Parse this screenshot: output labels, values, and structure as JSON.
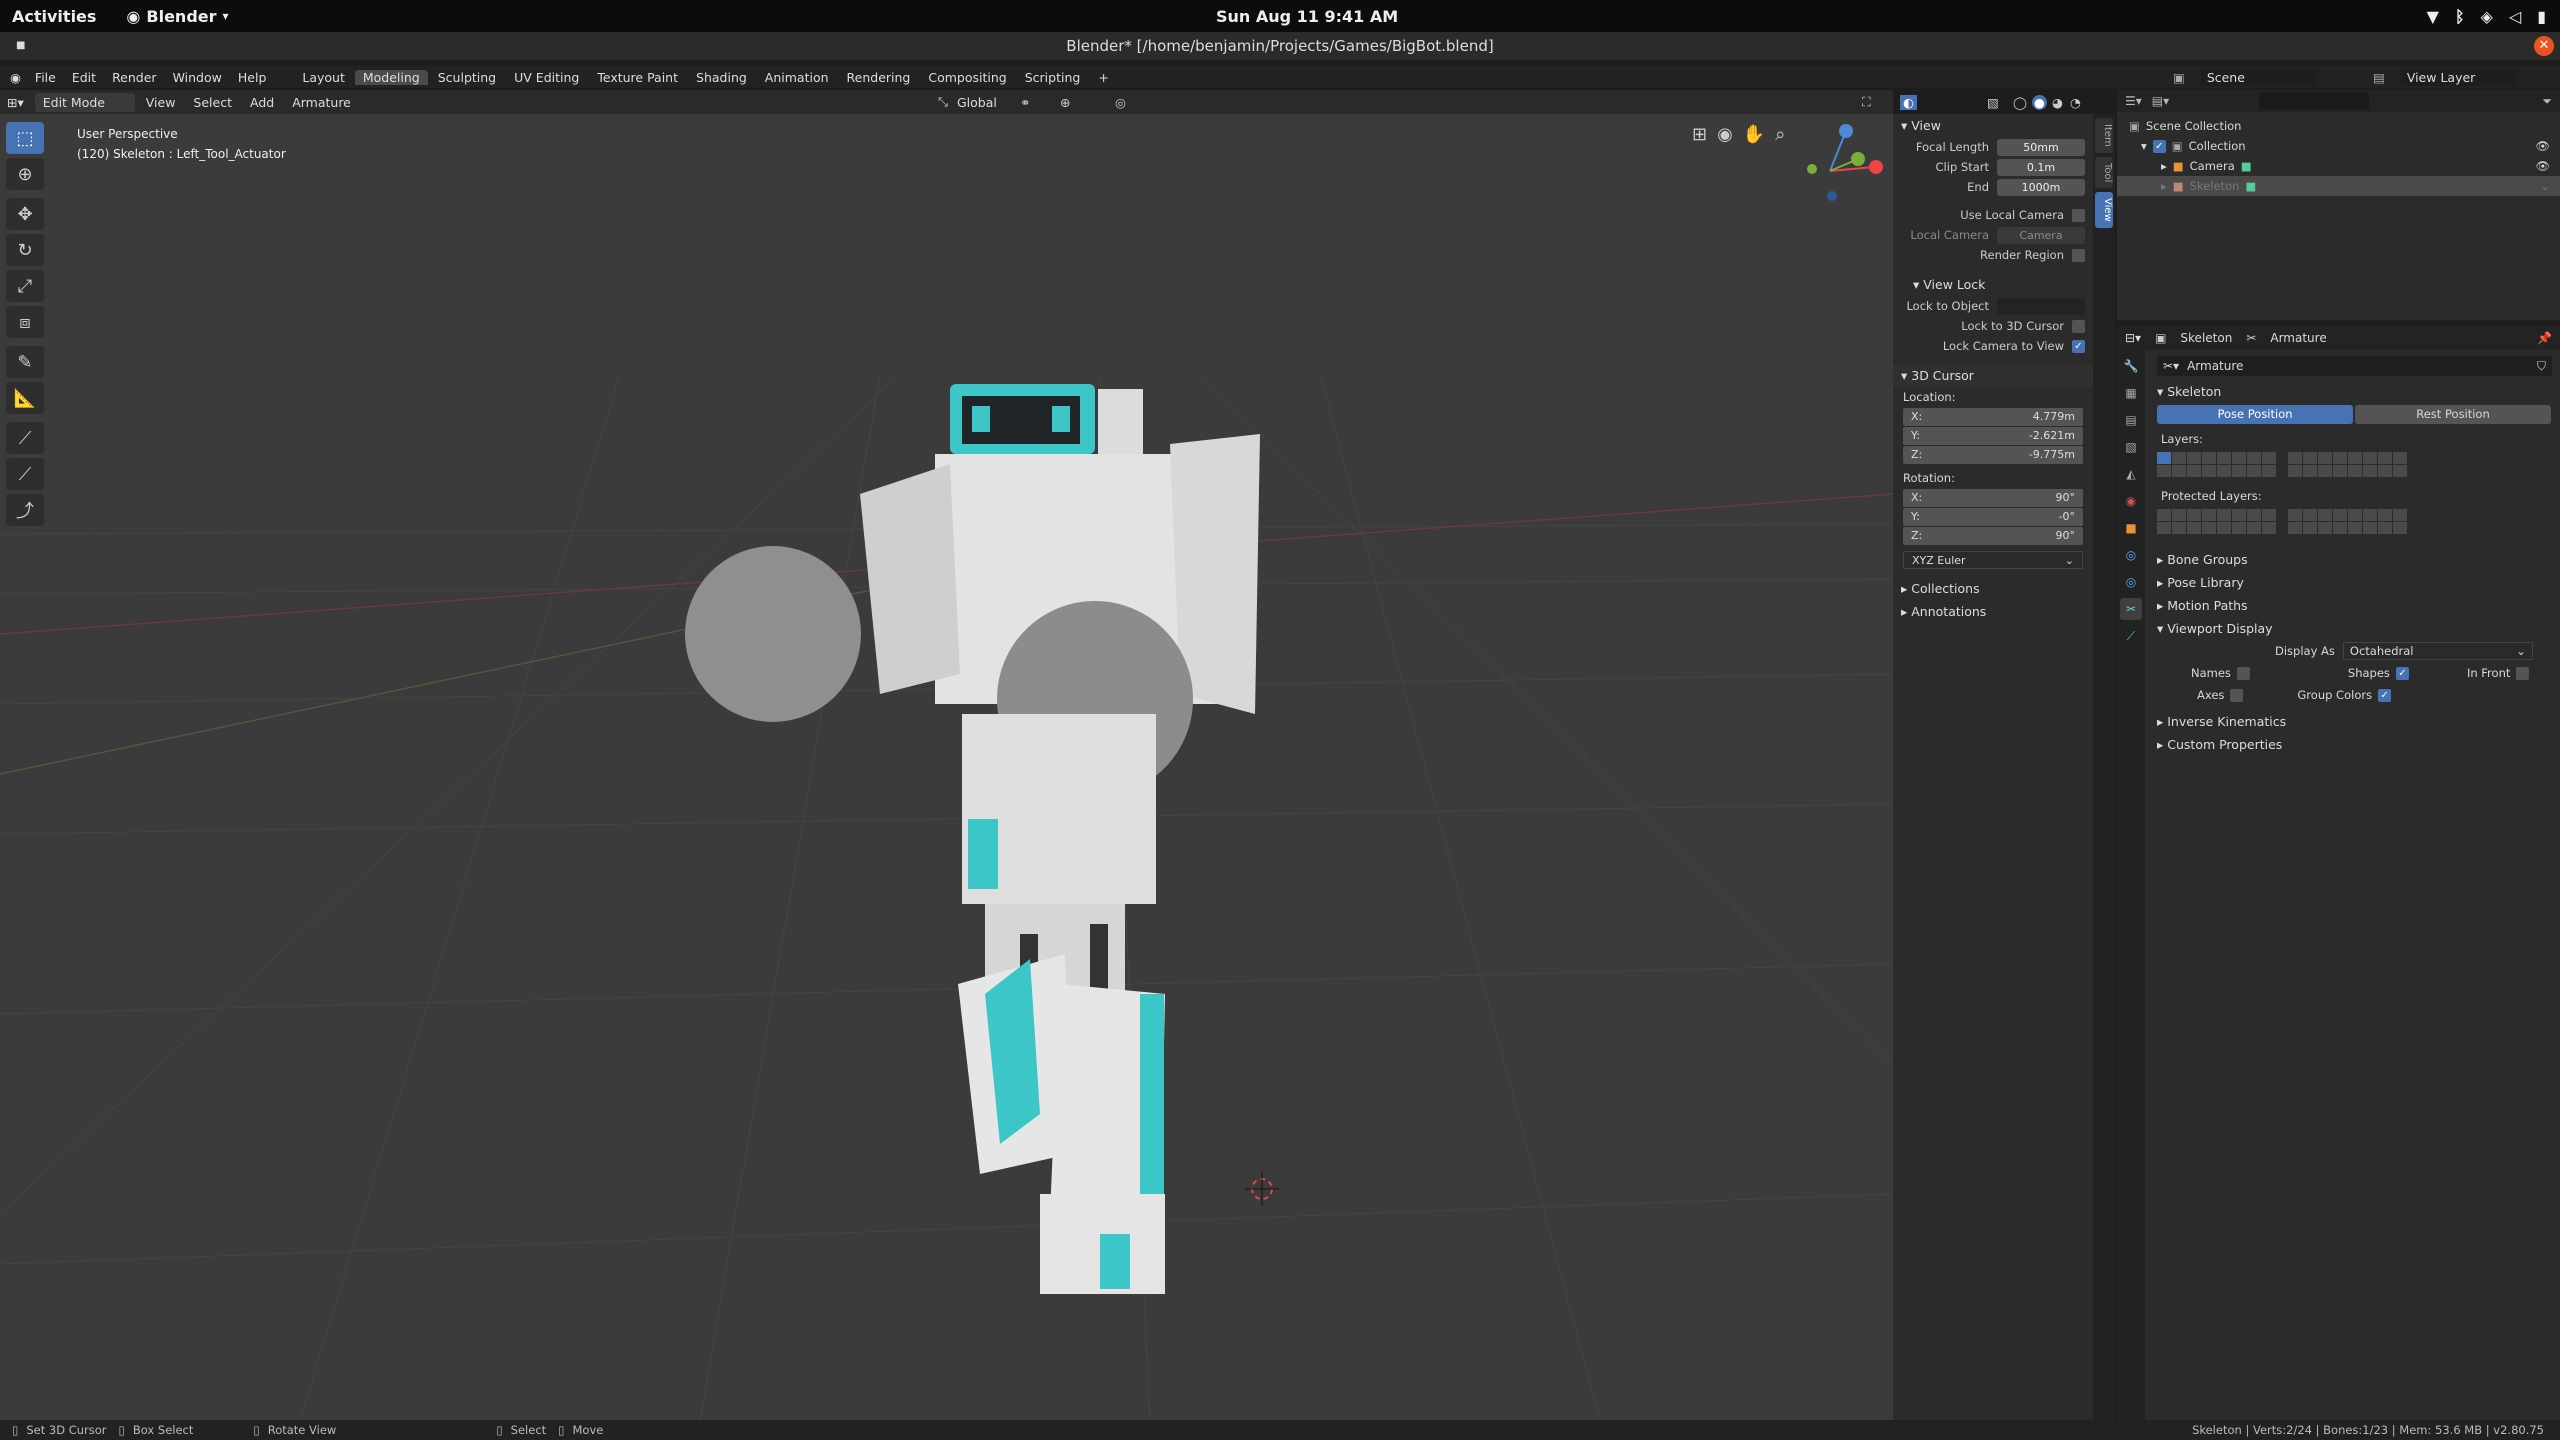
{
  "gnome": {
    "activities": "Activities",
    "app": "Blender",
    "app_caret": "▾",
    "clock": "Sun Aug 11  9:41 AM"
  },
  "title": "Blender* [/home/benjamin/Projects/Games/BigBot.blend]",
  "menu": [
    "File",
    "Edit",
    "Render",
    "Window",
    "Help"
  ],
  "workspaces": [
    "Layout",
    "Modeling",
    "Sculpting",
    "UV Editing",
    "Texture Paint",
    "Shading",
    "Animation",
    "Rendering",
    "Compositing",
    "Scripting"
  ],
  "workspace_plus": "+",
  "active_workspace": "Modeling",
  "viewport_header": {
    "mode": "Edit Mode",
    "menus": [
      "View",
      "Select",
      "Add",
      "Armature"
    ],
    "orientation": "Global"
  },
  "overlay_text": {
    "perspective": "User Perspective",
    "object": "(120) Skeleton : Left_Tool_Actuator"
  },
  "npanel": {
    "tabs": [
      "Item",
      "Tool",
      "View"
    ],
    "active_tab": "View",
    "view_section": "View",
    "focal_length": {
      "label": "Focal Length",
      "value": "50mm"
    },
    "clip_start": {
      "label": "Clip Start",
      "value": "0.1m"
    },
    "clip_end": {
      "label": "End",
      "value": "1000m"
    },
    "use_local_camera": "Use Local Camera",
    "local_camera": {
      "label": "Local Camera",
      "value": "Camera"
    },
    "render_region": "Render Region",
    "view_lock_section": "View Lock",
    "lock_to_object": "Lock to Object",
    "lock_to_3d_cursor": "Lock to 3D Cursor",
    "lock_camera_to_view": "Lock Camera to View",
    "cursor_section": "3D Cursor",
    "location_label": "Location:",
    "location": [
      {
        "axis": "X:",
        "value": "4.779m"
      },
      {
        "axis": "Y:",
        "value": "-2.621m"
      },
      {
        "axis": "Z:",
        "value": "-9.775m"
      }
    ],
    "rotation_label": "Rotation:",
    "rotation": [
      {
        "axis": "X:",
        "value": "90°"
      },
      {
        "axis": "Y:",
        "value": "-0°"
      },
      {
        "axis": "Z:",
        "value": "90°"
      }
    ],
    "rotation_mode": "XYZ Euler",
    "collections": "Collections",
    "annotations": "Annotations"
  },
  "outliner": {
    "scene": "Scene",
    "view_layer": "View Layer",
    "items": [
      "Scene Collection",
      "Collection",
      "Camera",
      "Skeleton"
    ]
  },
  "properties": {
    "breadcrumb": [
      "Skeleton",
      "Armature"
    ],
    "datablock": "Armature",
    "skeleton_section": "Skeleton",
    "pose_position": "Pose Position",
    "rest_position": "Rest Position",
    "layers_label": "Layers:",
    "protected_layers_label": "Protected Layers:",
    "panels": [
      "Bone Groups",
      "Pose Library",
      "Motion Paths",
      "Viewport Display"
    ],
    "display_as_label": "Display As",
    "display_as": "Octahedral",
    "names": "Names",
    "shapes": "Shapes",
    "in_front": "In Front",
    "axes": "Axes",
    "group_colors": "Group Colors",
    "panels2": [
      "Inverse Kinematics",
      "Custom Properties"
    ]
  },
  "statusbar": {
    "set_cursor": "Set 3D Cursor",
    "box_select": "Box Select",
    "rotate_view": "Rotate View",
    "select": "Select",
    "move": "Move",
    "info": "Skeleton | Verts:2/24 | Bones:1/23 | Mem: 53.6 MB | v2.80.75"
  },
  "colors": {
    "accent": "#4772b3",
    "teal": "#3cc6c8"
  }
}
